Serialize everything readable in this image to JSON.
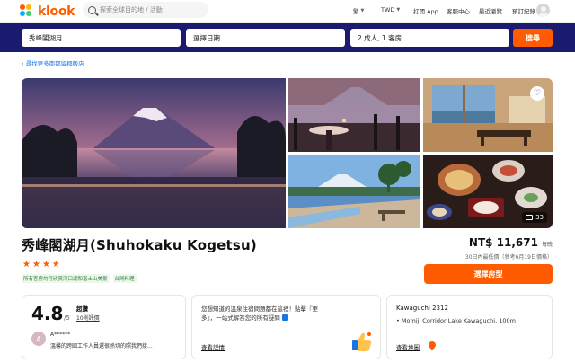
{
  "brand": {
    "name": "klook",
    "accent": "#ff5b00",
    "navy": "#1a1a6e"
  },
  "topnav": {
    "search_placeholder": "探索全球目的地 / 活動",
    "language": "繁",
    "currency": "TWD",
    "app_link": "打開 App",
    "help": "客服中心",
    "recently_viewed": "最近瀏覽",
    "bookings": "預訂紀錄"
  },
  "search_bar": {
    "destination": "秀峰閣湖月",
    "date": "選擇日期",
    "guests": "2 成人, 1 客房",
    "submit": "搜尋"
  },
  "back_link": "‹ 尋找更多南都留郡飯店",
  "gallery": {
    "photo_count": "33",
    "icons": [
      "heart-icon",
      "image-icon"
    ]
  },
  "hotel": {
    "name": "秀峰閣湖月(Shuhokaku Kogetsu)",
    "star_rating": 4,
    "tags": [
      "所有客房均可欣賞河口湖和富士山美景",
      "台灣料理"
    ]
  },
  "pricing": {
    "price": "NT$ 11,671",
    "unit": "每晚",
    "note": "30日內最低價（參考6月19日價格）",
    "cta": "選擇房型"
  },
  "review_card": {
    "score": "4.8",
    "max": "/5",
    "rating_word": "超讚",
    "reviews_link": "10則評價",
    "reviewer_initial": "A",
    "reviewer_name": "A******",
    "review_text": "溫馨的跨國工作人員還很熱切的照我們接..."
  },
  "info_card": {
    "line1": "您想知道的溫泉住宿問題都在這裡！點擊『更",
    "line2": "多』，一站式解答您的所有疑問",
    "details_link": "查看詳情"
  },
  "location_card": {
    "title": "Kawaguchi 2312",
    "address": "• Momiji Corridor Lake Kawaguchi, 100m",
    "map_link": "查看地圖"
  }
}
